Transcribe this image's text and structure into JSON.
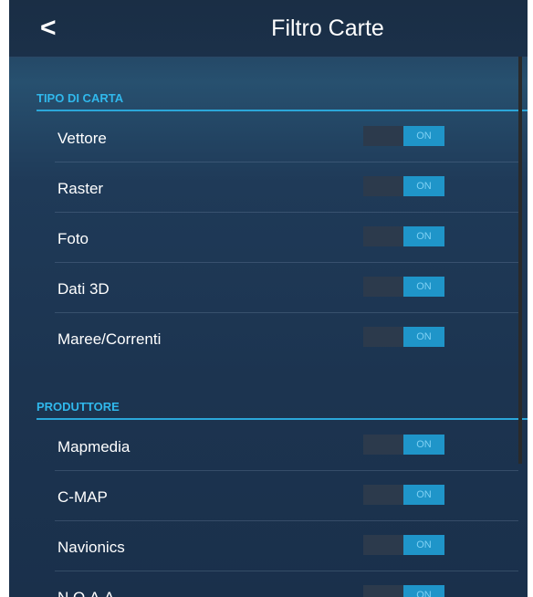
{
  "header": {
    "back_icon": "chevron-left-icon",
    "back_glyph": "<",
    "title": "Filtro Carte"
  },
  "sections": [
    {
      "title": "TIPO DI CARTA",
      "items": [
        {
          "label": "Vettore",
          "state": "ON"
        },
        {
          "label": "Raster",
          "state": "ON"
        },
        {
          "label": "Foto",
          "state": "ON"
        },
        {
          "label": "Dati 3D",
          "state": "ON"
        },
        {
          "label": "Maree/Correnti",
          "state": "ON"
        }
      ]
    },
    {
      "title": "PRODUTTORE",
      "items": [
        {
          "label": "Mapmedia",
          "state": "ON"
        },
        {
          "label": "C-MAP",
          "state": "ON"
        },
        {
          "label": "Navionics",
          "state": "ON"
        },
        {
          "label": "N.O.A.A.",
          "state": "ON"
        }
      ]
    }
  ],
  "colors": {
    "accent": "#2ba7d9",
    "toggle_on": "#1f95c9",
    "background": "#1f3a58"
  }
}
